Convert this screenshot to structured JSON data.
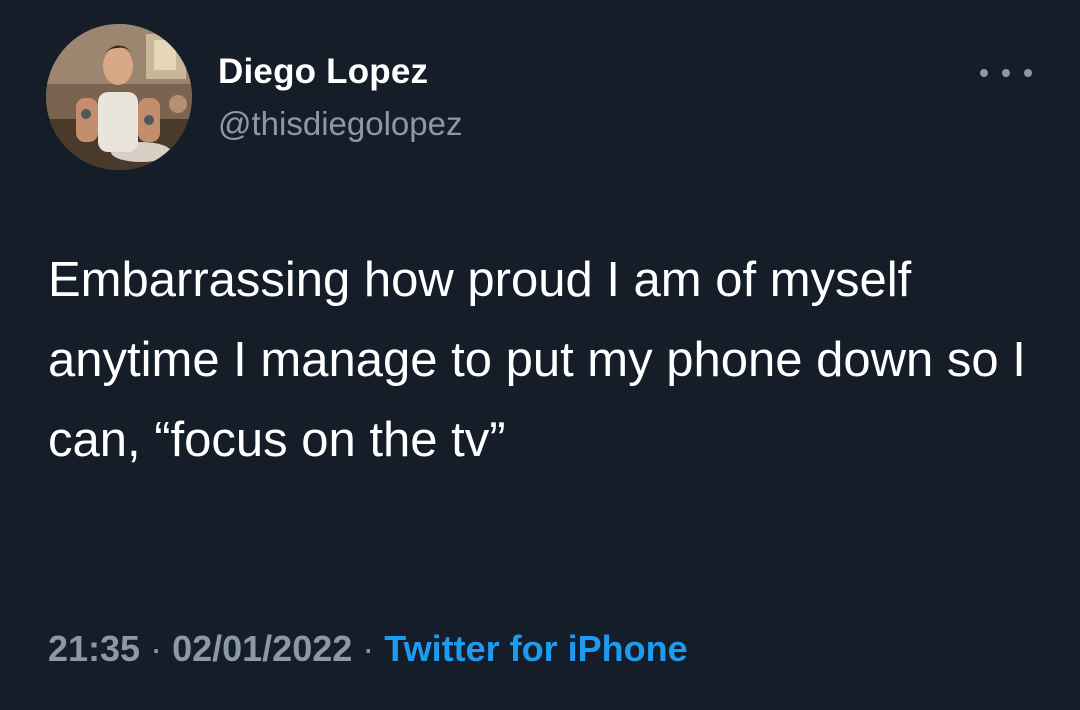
{
  "tweet": {
    "author_name": "Diego Lopez",
    "author_handle": "@thisdiegolopez",
    "text": "Embarrassing how proud I am of myself anytime I manage to put my phone down so I can, “focus on the tv”",
    "time": "21:35",
    "date": "02/01/2022",
    "separator": "·",
    "source": "Twitter for iPhone"
  },
  "icons": {
    "more": "more-horizontal-icon"
  },
  "colors": {
    "background": "#151d28",
    "primary_text": "#ffffff",
    "secondary_text": "#8b98a5",
    "link": "#1d9bf0"
  }
}
